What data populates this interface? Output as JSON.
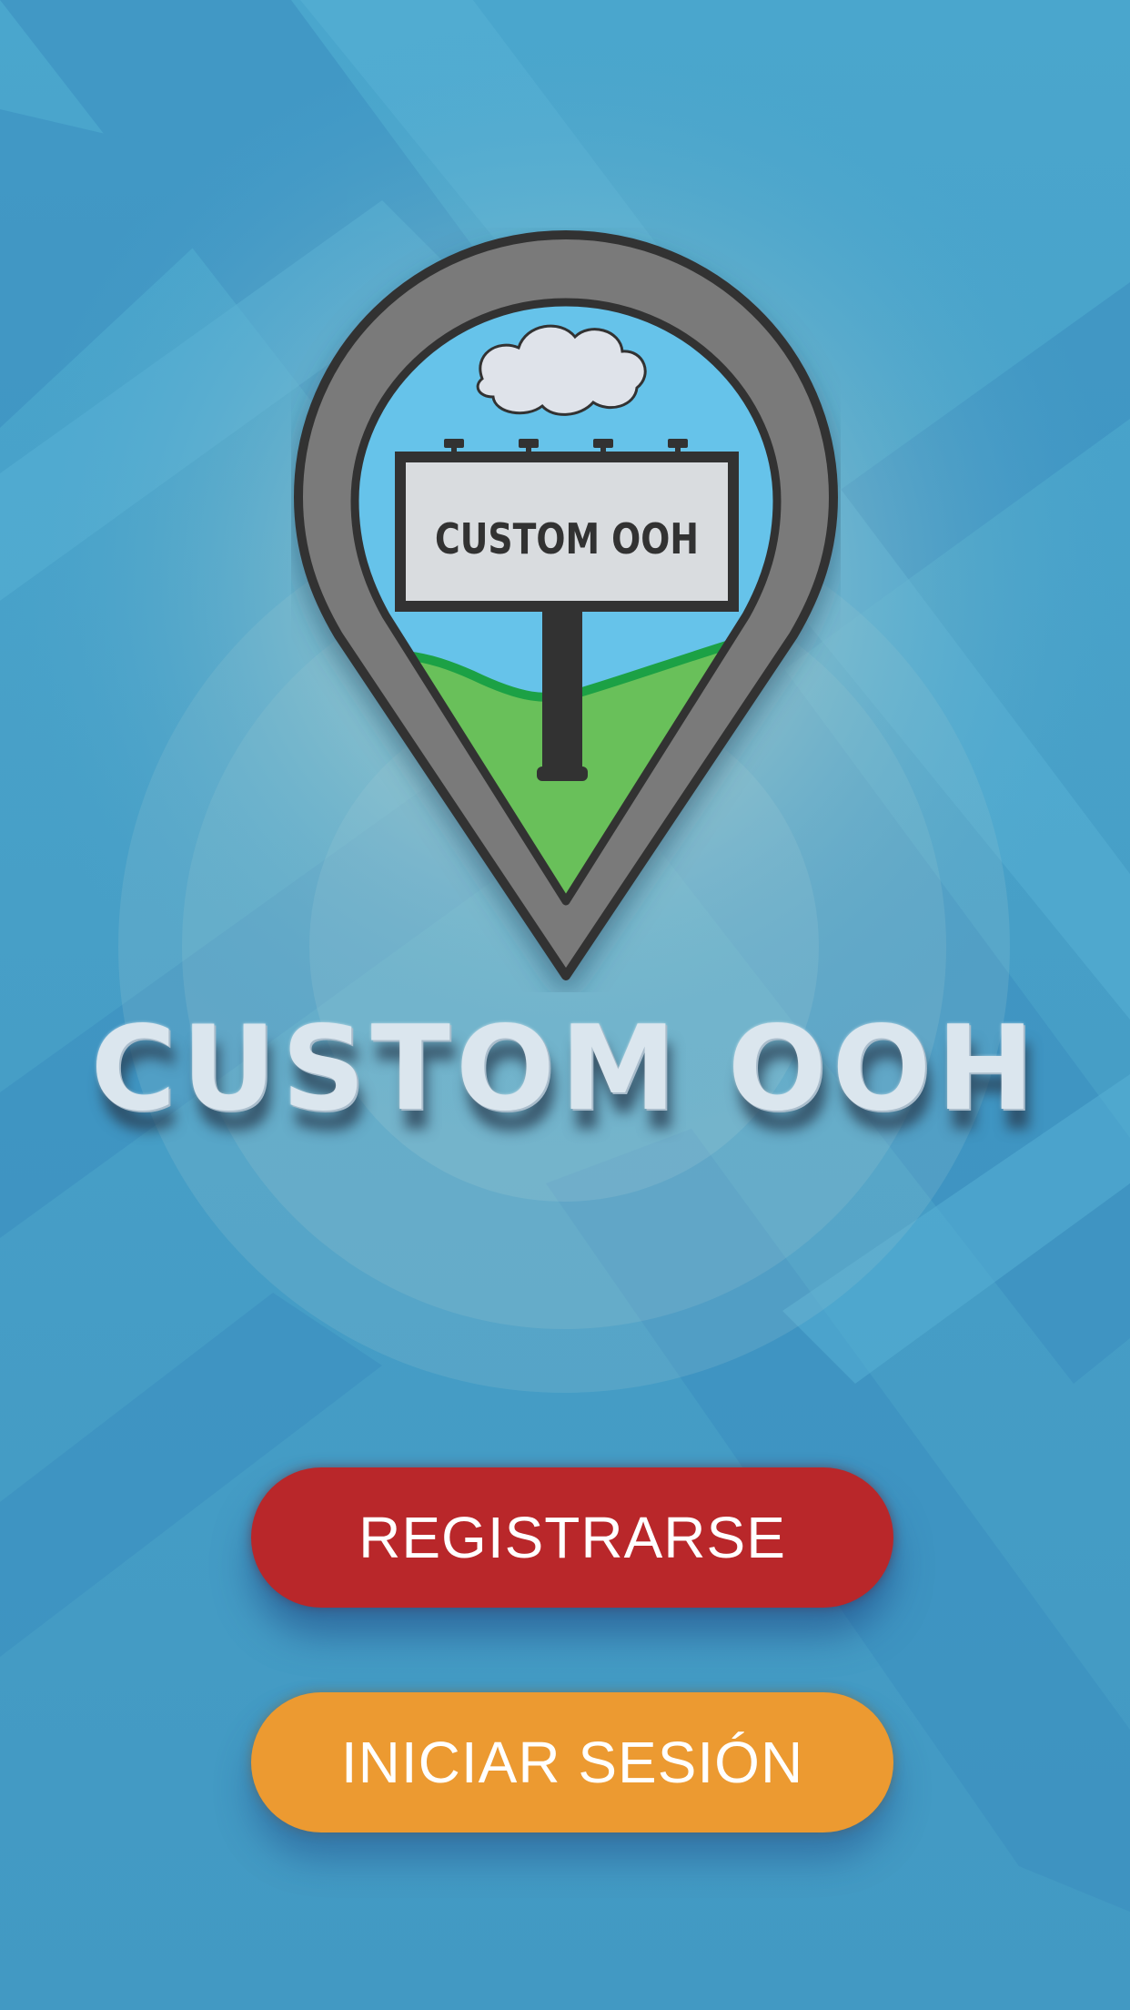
{
  "app": {
    "title": "CUSTOM OOH"
  },
  "logo": {
    "sign_text": "CUSTOM OOH",
    "icon": "billboard-map-pin-icon"
  },
  "actions": {
    "register_label": "REGISTRARSE",
    "login_label": "INICIAR SESIÓN"
  },
  "colors": {
    "background": "#45a0c8",
    "register_button": "#b9272a",
    "login_button": "#ec9a31",
    "pin_ring": "#7a7a7a",
    "pin_outline": "#333333",
    "sky": "#66c3ea",
    "grass": "#69c05a",
    "grass_edge": "#1fa145",
    "billboard_panel": "#d9dcdf"
  }
}
